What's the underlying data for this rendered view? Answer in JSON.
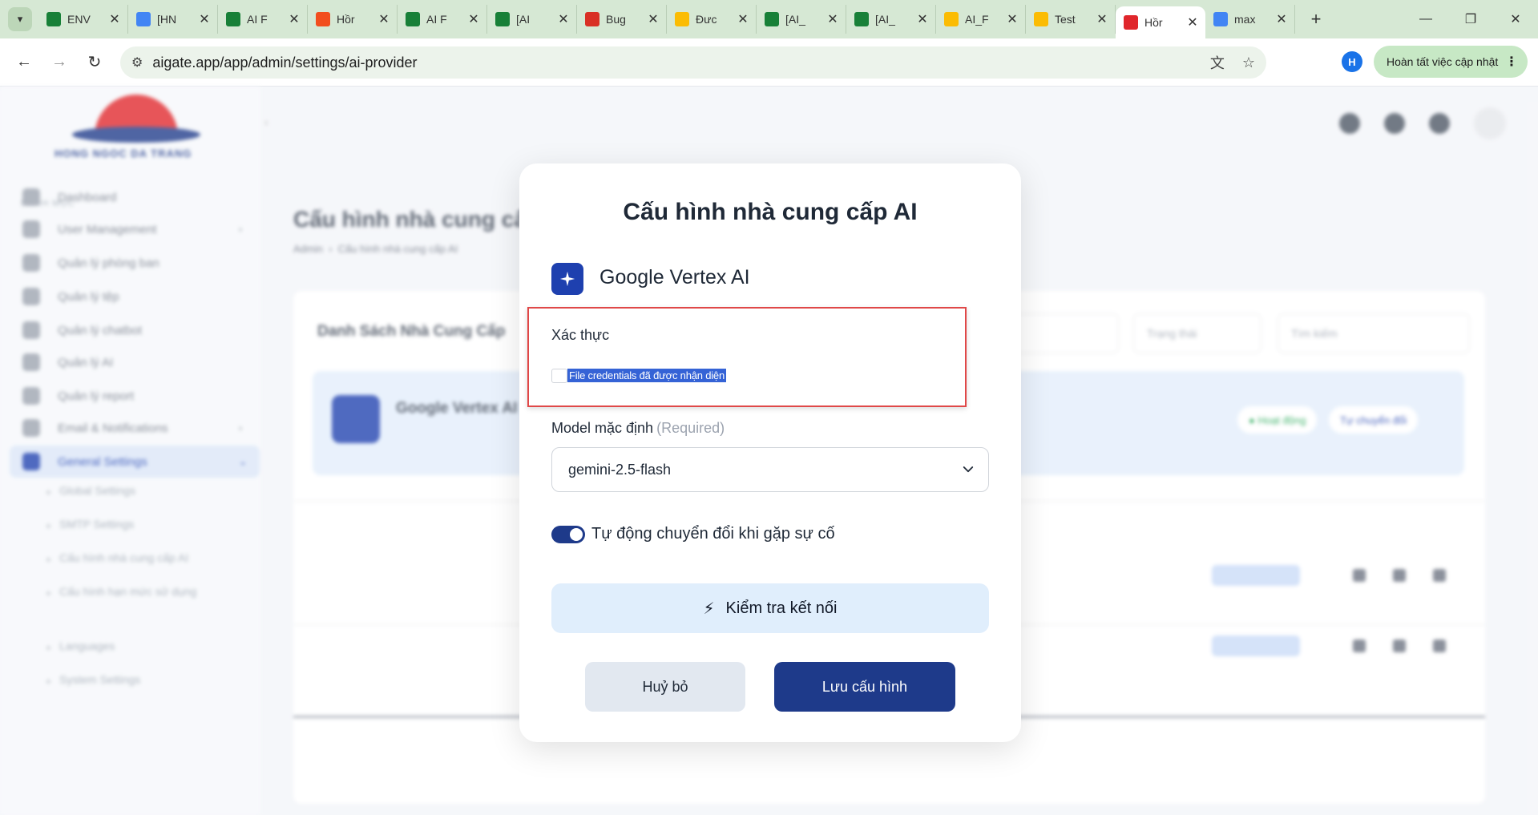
{
  "browser": {
    "tabs": [
      {
        "title": "ENV",
        "icon": "sheets-icon",
        "color": "#188038",
        "active": false
      },
      {
        "title": "[HN",
        "icon": "docs-icon",
        "color": "#4285f4",
        "active": false
      },
      {
        "title": "AI F",
        "icon": "sheets-icon",
        "color": "#188038",
        "active": false
      },
      {
        "title": "Hồr",
        "icon": "figma-icon",
        "color": "#f24e1e",
        "active": false
      },
      {
        "title": "AI F",
        "icon": "sheets-icon",
        "color": "#188038",
        "active": false
      },
      {
        "title": "[AI",
        "icon": "sheets-icon",
        "color": "#188038",
        "active": false
      },
      {
        "title": "Bug",
        "icon": "bug-tracker-icon",
        "color": "#d93025",
        "active": false
      },
      {
        "title": "Đưc",
        "icon": "drive-icon",
        "color": "#fbbc04",
        "active": false
      },
      {
        "title": "[AI_",
        "icon": "sheets-icon",
        "color": "#188038",
        "active": false
      },
      {
        "title": "[AI_",
        "icon": "sheets-icon",
        "color": "#188038",
        "active": false
      },
      {
        "title": "AI_F",
        "icon": "drive-icon",
        "color": "#fbbc04",
        "active": false
      },
      {
        "title": "Test",
        "icon": "drive-icon",
        "color": "#fbbc04",
        "active": false
      },
      {
        "title": "Hồr",
        "icon": "app-logo-icon",
        "color": "#e0262b",
        "active": true
      },
      {
        "title": "max",
        "icon": "google-icon",
        "color": "#4285f4",
        "active": false
      }
    ],
    "url": "aigate.app/app/admin/settings/ai-provider",
    "profile_initial": "H",
    "update_label": "Hoàn tất việc cập nhật"
  },
  "modal": {
    "title": "Cấu hình nhà cung cấp AI",
    "provider_name": "Google Vertex AI",
    "auth_label": "Xác thực",
    "credentials_text": "File credentials đã được nhận diện",
    "model_label": "Model mặc định",
    "model_required": "(Required)",
    "model_value": "gemini-2.5-flash",
    "auto_switch_label": "Tự động chuyển đổi khi gặp sự cố",
    "auto_switch_on": true,
    "test_button": "Kiểm tra kết nối",
    "cancel_button": "Huỷ bỏ",
    "save_button": "Lưu cấu hình"
  },
  "colors": {
    "primary": "#1e3a8a",
    "highlight_border": "#e04848",
    "test_button_bg": "#e0eefc"
  }
}
